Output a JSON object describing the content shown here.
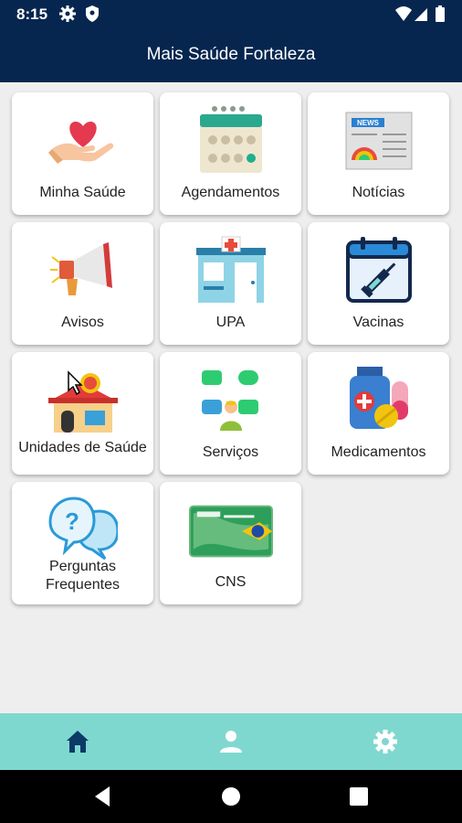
{
  "status_bar": {
    "time": "8:15",
    "icons": [
      "gear-icon",
      "shield-icon",
      "wifi-icon",
      "signal-icon",
      "battery-icon"
    ]
  },
  "app_bar": {
    "title": "Mais Saúde Fortaleza"
  },
  "menu": {
    "items": [
      {
        "label": "Minha Saúde",
        "icon": "heart-hand-icon"
      },
      {
        "label": "Agendamentos",
        "icon": "calendar-icon"
      },
      {
        "label": "Notícias",
        "icon": "newspaper-icon"
      },
      {
        "label": "Avisos",
        "icon": "megaphone-icon"
      },
      {
        "label": "UPA",
        "icon": "clinic-icon"
      },
      {
        "label": "Vacinas",
        "icon": "vaccine-calendar-icon"
      },
      {
        "label": "Unidades de Saúde",
        "icon": "health-unit-icon"
      },
      {
        "label": "Serviços",
        "icon": "services-icon"
      },
      {
        "label": "Medicamentos",
        "icon": "medicine-icon"
      },
      {
        "label": "Perguntas Frequentes",
        "icon": "faq-icon"
      },
      {
        "label": "CNS",
        "icon": "health-card-icon"
      }
    ]
  },
  "bottom_nav": {
    "items": [
      {
        "icon": "home-icon",
        "active": true
      },
      {
        "icon": "person-icon",
        "active": false
      },
      {
        "icon": "settings-icon",
        "active": false
      }
    ]
  },
  "system_nav": {
    "items": [
      "back-icon",
      "home-circle-icon",
      "recents-icon"
    ]
  },
  "colors": {
    "app_bar": "#06264f",
    "bottom_nav": "#7fd8cf",
    "active_nav_icon": "#0b3a66",
    "inactive_nav_icon": "#ffffff"
  }
}
